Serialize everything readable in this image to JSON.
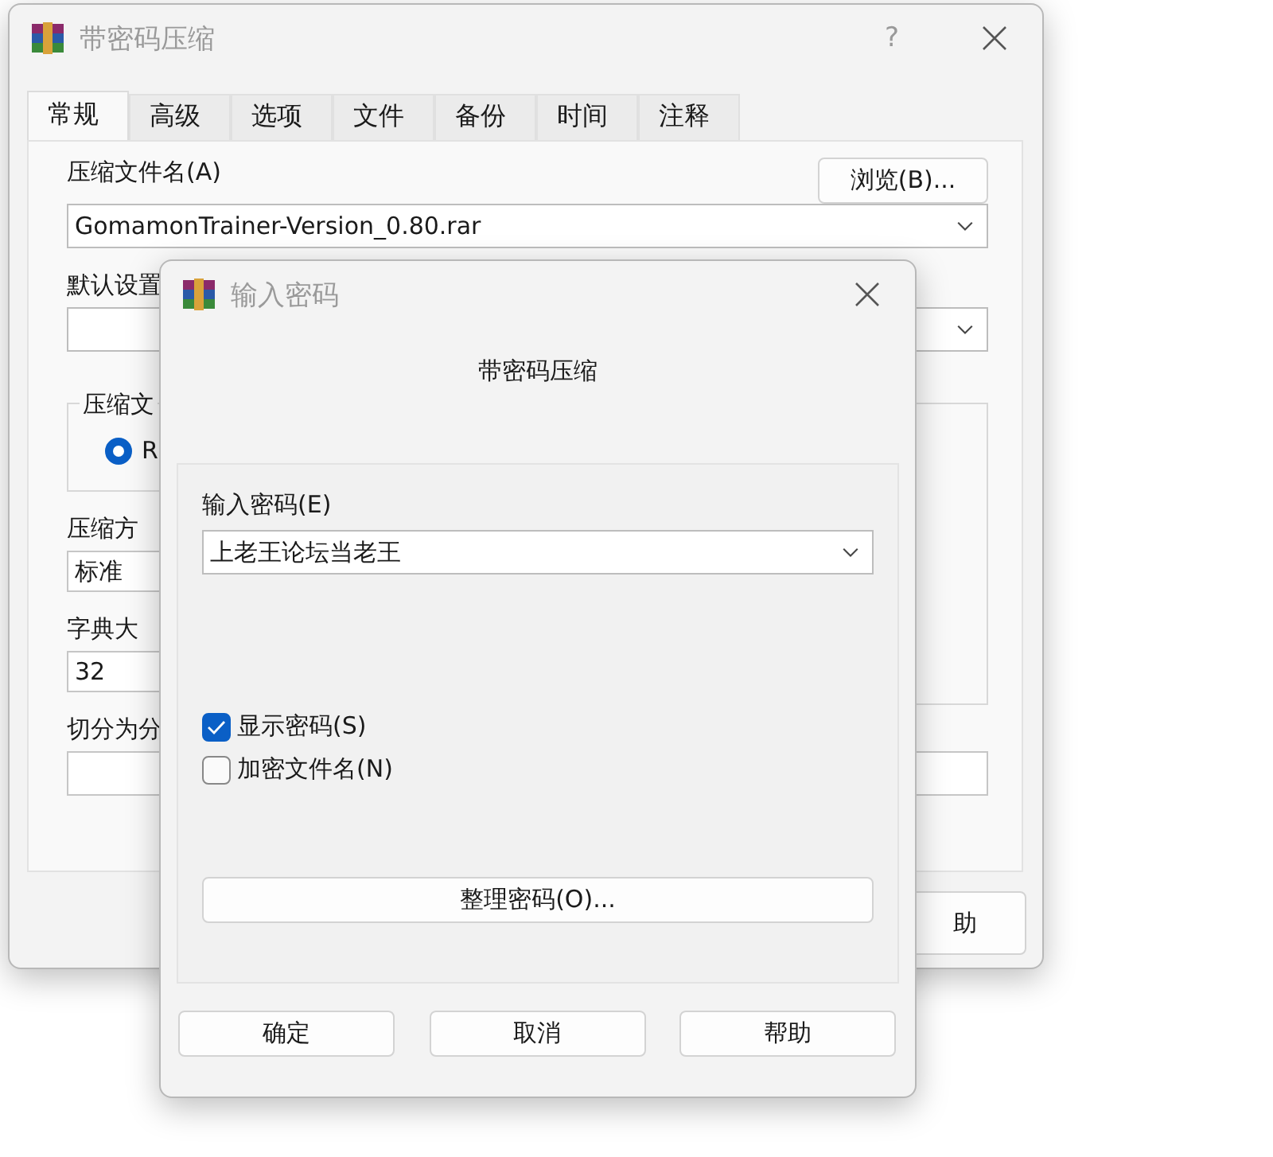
{
  "main_window": {
    "title": "带密码压缩",
    "help": "?",
    "tabs": [
      {
        "label": "常规",
        "selected": true
      },
      {
        "label": "高级",
        "selected": false
      },
      {
        "label": "选项",
        "selected": false
      },
      {
        "label": "文件",
        "selected": false
      },
      {
        "label": "备份",
        "selected": false
      },
      {
        "label": "时间",
        "selected": false
      },
      {
        "label": "注释",
        "selected": false
      }
    ],
    "archive_name_label": "压缩文件名(A)",
    "browse_button": "浏览(B)...",
    "archive_name": "GomamonTrainer-Version_0.80.rar",
    "profile_label": "默认设置",
    "format_group_label": "压缩文",
    "format_option": {
      "label": "R",
      "selected": true
    },
    "method_label": "压缩方",
    "method": "标准",
    "dictionary_label": "字典大",
    "dictionary": "32",
    "split_label": "切分为分",
    "help_button": "助"
  },
  "password_dialog": {
    "title": "输入密码",
    "subtitle": "带密码压缩",
    "password_label": "输入密码(E)",
    "password": "上老王论坛当老王",
    "options": [
      {
        "label": "显示密码(S)",
        "checked": true
      },
      {
        "label": "加密文件名(N)",
        "checked": false
      }
    ],
    "organize_button": "整理密码(O)...",
    "buttons": [
      "确定",
      "取消",
      "帮助"
    ]
  }
}
